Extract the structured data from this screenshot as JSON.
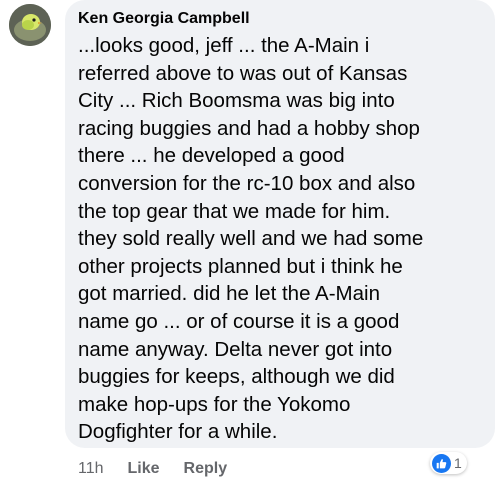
{
  "comment": {
    "author": "Ken Georgia Campbell",
    "lines": [
      "...looks good, jeff ... the A-Main i",
      "referred above to was out of Kansas",
      "City ...  Rich Boomsma was big into",
      "racing buggies and had a hobby shop",
      "there ... he developed a good",
      "conversion for the rc-10 box and also",
      "the top gear that we made for him.",
      "they sold really well and we had some",
      "other projects planned but i think he",
      "got married.  did he let the A-Main",
      "name go ... or of course it is a good",
      "name anyway.  Delta never got into",
      "buggies for keeps, although we did",
      "make hop-ups for the Yokomo",
      "Dogfighter for a while."
    ],
    "timestamp": "11h",
    "like_label": "Like",
    "reply_label": "Reply",
    "reaction": {
      "icon": "like-thumb-icon",
      "count": "1",
      "color": "#1877f2"
    }
  },
  "colors": {
    "bubble": "#f0f2f5",
    "text": "#050505",
    "secondary": "#65676b"
  }
}
